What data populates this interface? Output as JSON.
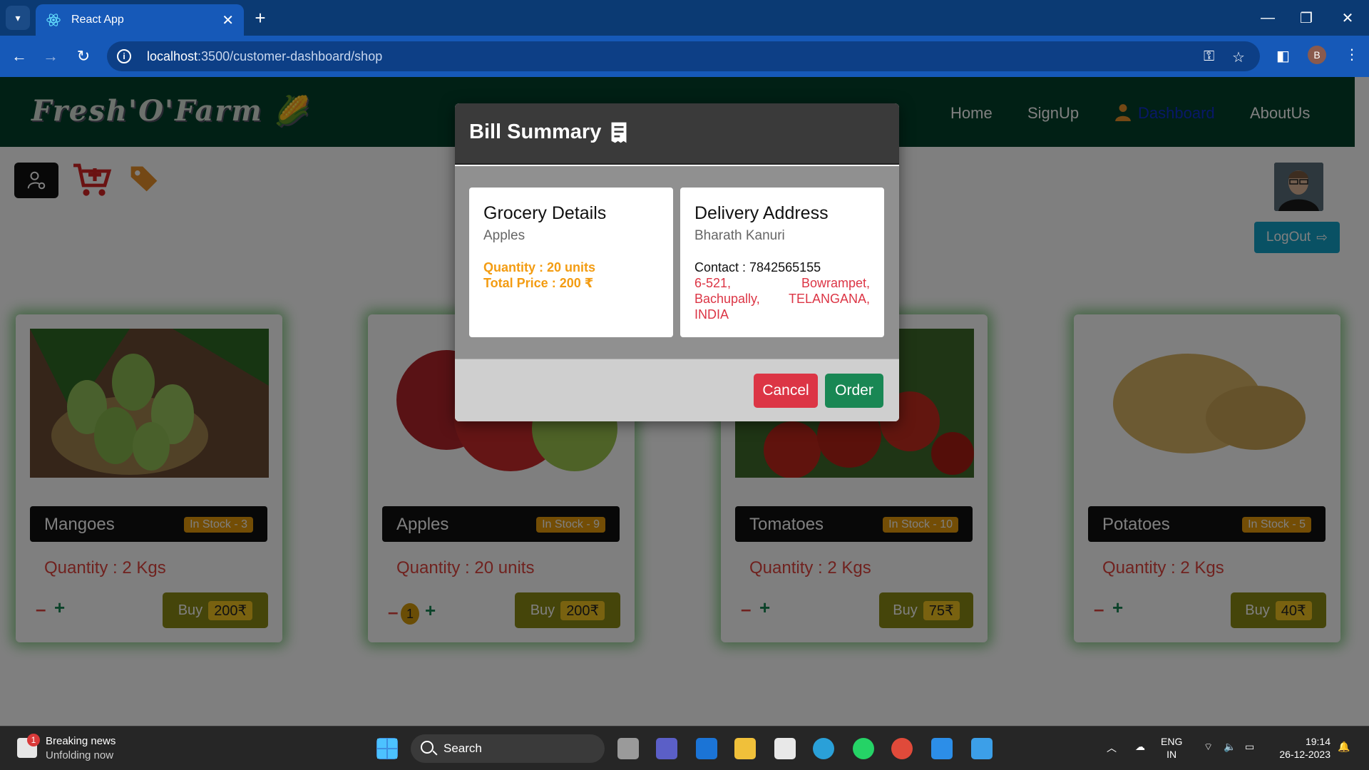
{
  "browser": {
    "tab_title": "React App",
    "url_host": "localhost",
    "url_path": ":3500/customer-dashboard/shop",
    "profile_initial": "B"
  },
  "site": {
    "logo": "Fresh'O'Farm",
    "nav": {
      "home": "Home",
      "signup": "SignUp",
      "dashboard": "Dashboard",
      "about": "AboutUs"
    },
    "logout": "LogOut"
  },
  "products": [
    {
      "name": "Mangoes",
      "stock": "In Stock - 3",
      "quantity": "Quantity : 2 Kgs",
      "buy": "Buy",
      "price": "200₹",
      "count": ""
    },
    {
      "name": "Apples",
      "stock": "In Stock - 9",
      "quantity": "Quantity : 20 units",
      "buy": "Buy",
      "price": "200₹",
      "count": "1"
    },
    {
      "name": "Tomatoes",
      "stock": "In Stock - 10",
      "quantity": "Quantity : 2 Kgs",
      "buy": "Buy",
      "price": "75₹",
      "count": ""
    },
    {
      "name": "Potatoes",
      "stock": "In Stock - 5",
      "quantity": "Quantity : 2 Kgs",
      "buy": "Buy",
      "price": "40₹",
      "count": ""
    }
  ],
  "modal": {
    "title": "Bill Summary",
    "grocery": {
      "heading": "Grocery Details",
      "item": "Apples",
      "quantity": "Quantity : 20 units",
      "total": "Total Price : 200 ₹"
    },
    "delivery": {
      "heading": "Delivery Address",
      "name": "Bharath Kanuri",
      "contact": "Contact : 7842565155",
      "address_line1": "6-521, Bowrampet,",
      "address_line2": "Bachupally, TELANGANA,",
      "address_line3": "INDIA"
    },
    "cancel": "Cancel",
    "order": "Order"
  },
  "taskbar": {
    "news_badge": "1",
    "news_title": "Breaking news",
    "news_sub": "Unfolding now",
    "search": "Search",
    "lang1": "ENG",
    "lang2": "IN",
    "time": "19:14",
    "date": "26-12-2023"
  },
  "colors": {
    "header": "#03402a",
    "accent_orange": "#f39c12",
    "danger": "#dc3545",
    "success": "#198754"
  }
}
